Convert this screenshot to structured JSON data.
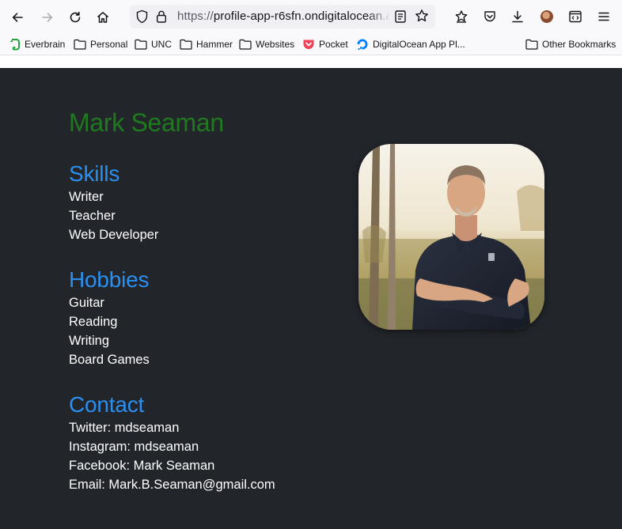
{
  "browser": {
    "url_scheme": "https://",
    "url_host": "profile-app-r6sfn.ondigitalocean.app",
    "bookmarks": [
      {
        "label": "Everbrain",
        "icon": "evernote-icon"
      },
      {
        "label": "Personal",
        "icon": "folder-icon"
      },
      {
        "label": "UNC",
        "icon": "folder-icon"
      },
      {
        "label": "Hammer",
        "icon": "folder-icon"
      },
      {
        "label": "Websites",
        "icon": "folder-icon"
      },
      {
        "label": "Pocket",
        "icon": "pocket-icon"
      },
      {
        "label": "DigitalOcean App Pl...",
        "icon": "digitalocean-icon"
      },
      {
        "label": "Other Bookmarks",
        "icon": "folder-icon"
      }
    ]
  },
  "profile": {
    "name": "Mark Seaman",
    "skills_title": "Skills",
    "skills": [
      "Writer",
      "Teacher",
      "Web Developer"
    ],
    "hobbies_title": "Hobbies",
    "hobbies": [
      "Guitar",
      "Reading",
      "Writing",
      "Board Games"
    ],
    "contact_title": "Contact",
    "contact": [
      "Twitter: mdseaman",
      "Instagram: mdseaman",
      "Facebook: Mark Seaman",
      "Email: Mark.B.Seaman@gmail.com"
    ]
  },
  "colors": {
    "page_background": "#22252a",
    "name": "#1f7a1f",
    "section_title": "#2b8ff0",
    "text": "#ffffff"
  }
}
